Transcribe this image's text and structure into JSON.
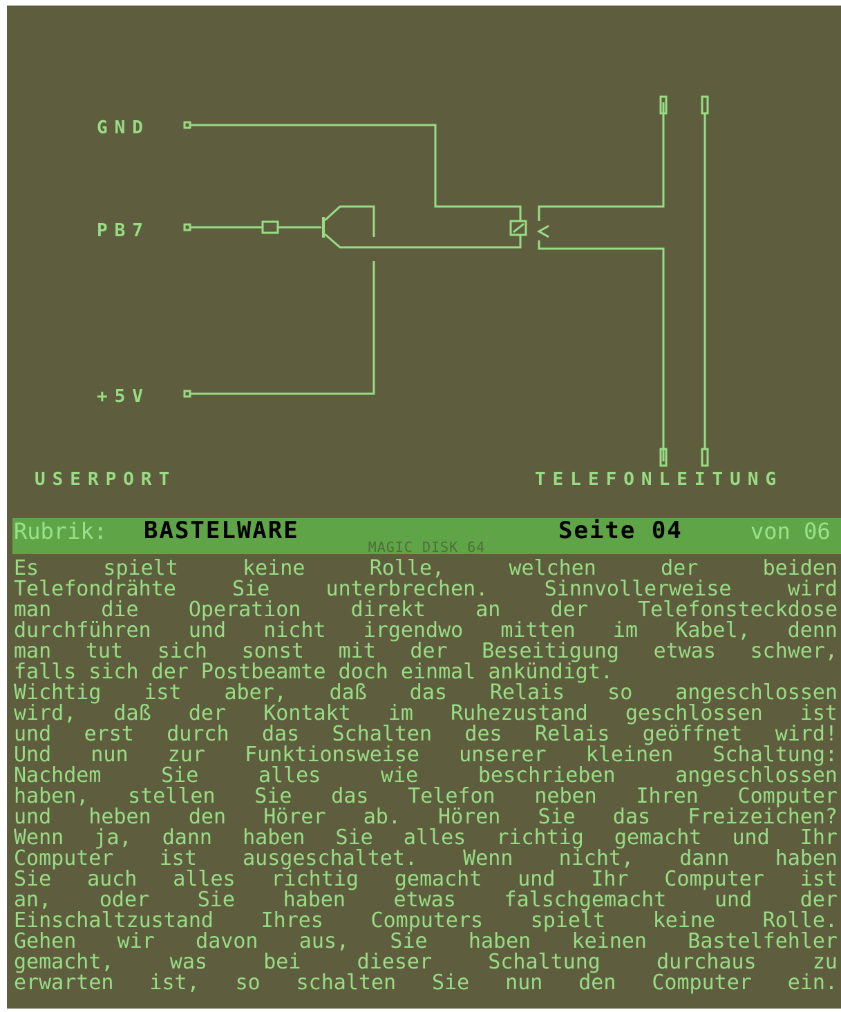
{
  "schematic": {
    "pins": [
      "GND",
      "PB7",
      "+5V"
    ],
    "left_label": "USERPORT",
    "right_label": "TELEFONLEITUNG"
  },
  "header": {
    "rubrik_label": "Rubrik:",
    "section": "BASTELWARE",
    "page": "Seite 04",
    "total": "von 06",
    "magazine": "MAGIC DISK 64"
  },
  "article": {
    "lines": [
      "Es spielt keine Rolle, welchen der beiden",
      "Telefondrähte Sie unterbrechen. Sinnvollerweise wird",
      "man die Operation direkt an der Telefonsteckdose",
      "durchführen und nicht irgendwo mitten im Kabel, denn",
      "man tut sich sonst mit der Beseitigung etwas schwer,",
      "falls sich der Postbeamte doch einmal ankündigt.",
      "Wichtig ist aber, daß das Relais so angeschlossen",
      "wird, daß der Kontakt im Ruhezustand geschlossen ist",
      "und erst durch das Schalten des Relais geöffnet wird!",
      "Und nun zur Funktionsweise unserer kleinen Schaltung:",
      "Nachdem Sie alles wie beschrieben angeschlossen",
      "haben, stellen Sie das Telefon neben Ihren Computer",
      "und heben den Hörer ab. Hören Sie das Freizeichen?",
      "Wenn ja, dann haben Sie alles richtig gemacht und Ihr",
      "Computer ist ausgeschaltet. Wenn nicht, dann haben",
      "Sie auch alles richtig gemacht und Ihr Computer ist",
      "an, oder Sie haben etwas falschgemacht und der",
      "Einschaltzustand Ihres Computers spielt keine Rolle.",
      "Gehen wir davon aus, Sie haben keinen Bastelfehler",
      "gemacht, was bei dieser Schaltung durchaus zu",
      "erwarten ist, so schalten Sie nun den Computer ein."
    ]
  }
}
